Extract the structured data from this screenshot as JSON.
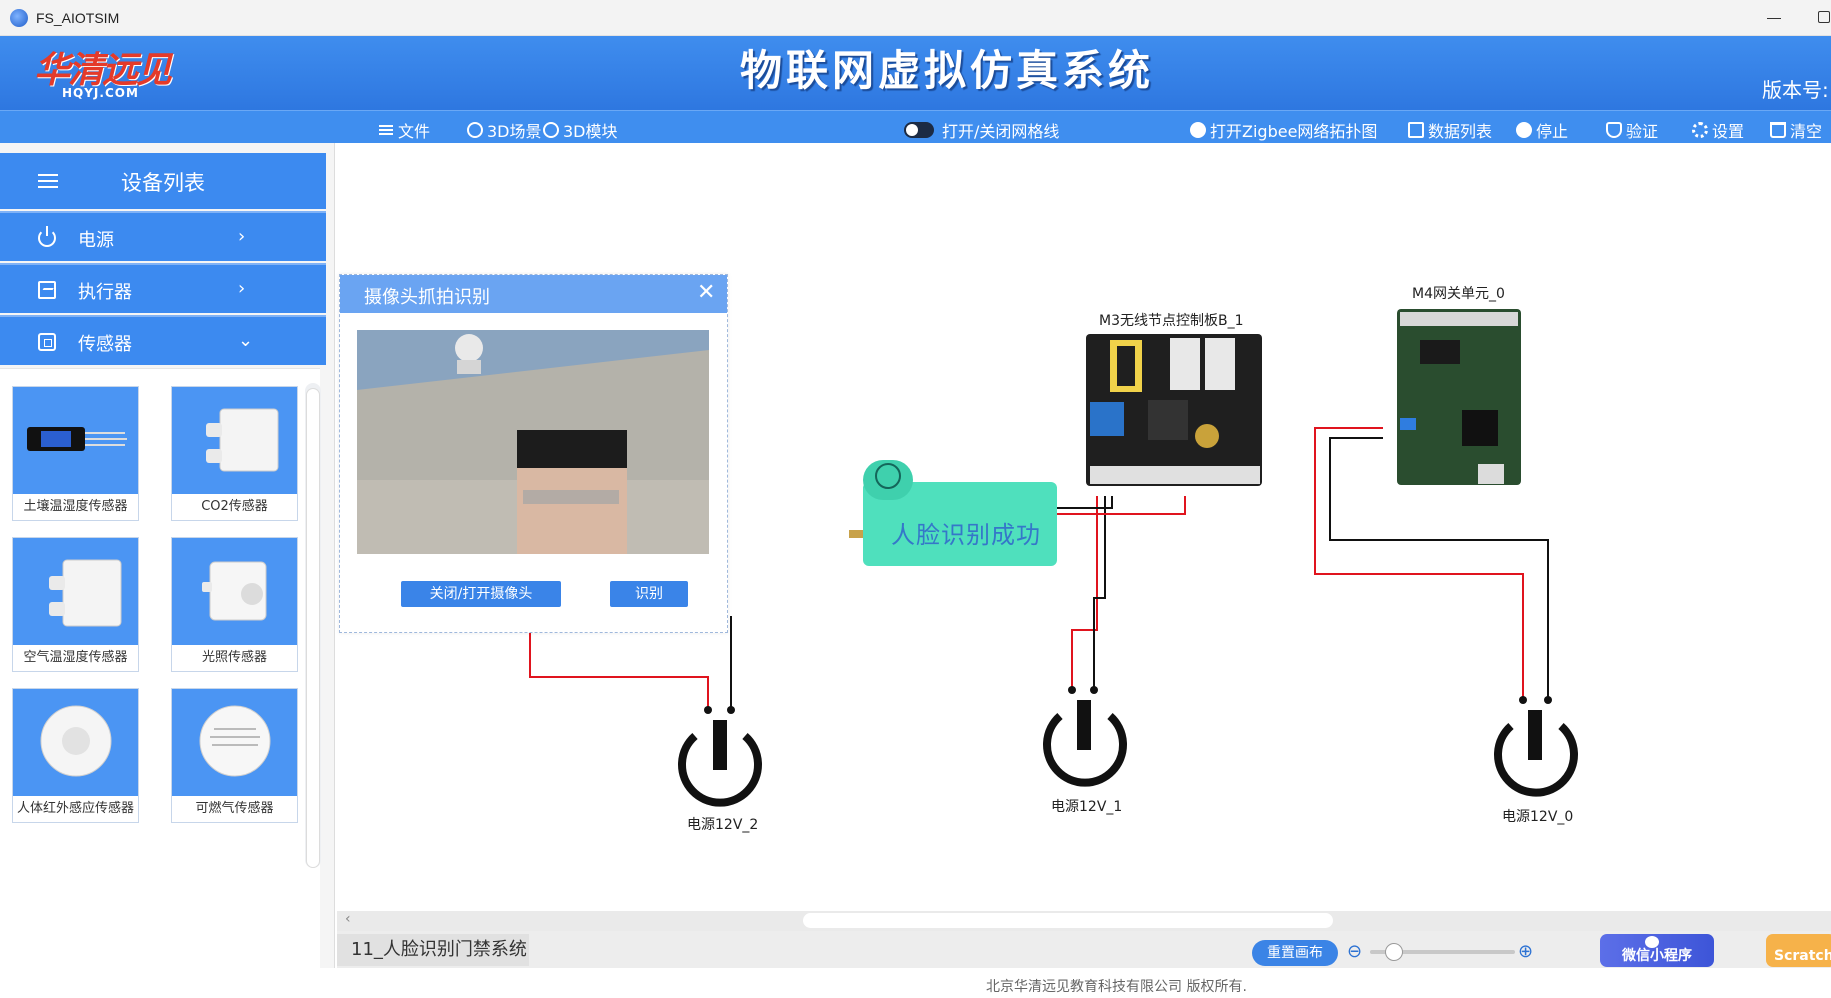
{
  "window": {
    "title": "FS_AIOTSIM"
  },
  "header": {
    "logo_cn": "华清远见",
    "logo_en": "HQYJ.COM",
    "system_title": "物联网虚拟仿真系统",
    "version_label": "版本号:"
  },
  "toolbar": {
    "file": "文件",
    "scene3d": "3D场景",
    "module3d": "3D模块",
    "grid_toggle": "打开/关闭网格线",
    "zigbee": "打开Zigbee网络拓扑图",
    "data_list": "数据列表",
    "stop": "停止",
    "verify": "验证",
    "settings": "设置",
    "clear": "清空"
  },
  "sidebar": {
    "title": "设备列表",
    "categories": [
      {
        "label": "电源",
        "chevron": "›"
      },
      {
        "label": "执行器",
        "chevron": "›"
      },
      {
        "label": "传感器",
        "chevron": "⌄"
      }
    ],
    "devices": [
      {
        "label": "土壤温湿度传感器"
      },
      {
        "label": "CO2传感器"
      },
      {
        "label": "空气温湿度传感器"
      },
      {
        "label": "光照传感器"
      },
      {
        "label": "人体红外感应传感器"
      },
      {
        "label": "可燃气传感器"
      }
    ]
  },
  "dialog": {
    "title": "摄像头抓拍识别",
    "close_glyph": "✕",
    "camera_button": "关闭/打开摄像头",
    "recognize_button": "识别"
  },
  "canvas": {
    "board_m3": "M3无线节点控制板B_1",
    "gateway_m4": "M4网关单元_0",
    "power_2": "电源12V_2",
    "power_1": "电源12V_1",
    "power_0": "电源12V_0",
    "status_message": "人脸识别成功"
  },
  "bottom": {
    "project_tab": "11_人脸识别门禁系统",
    "reset_button": "重置画布",
    "zoom_level": 0.1,
    "wechat_button": "微信小程序",
    "scratch_button": "Scratch"
  },
  "footer": {
    "copyright": "北京华清远见教育科技有限公司 版权所有."
  },
  "colors": {
    "header_blue": "#2e77e0",
    "toolbar_blue": "#3f8eef",
    "wire_red": "#e0141e",
    "wire_black": "#111111",
    "lock_teal": "#3fd8b4"
  }
}
